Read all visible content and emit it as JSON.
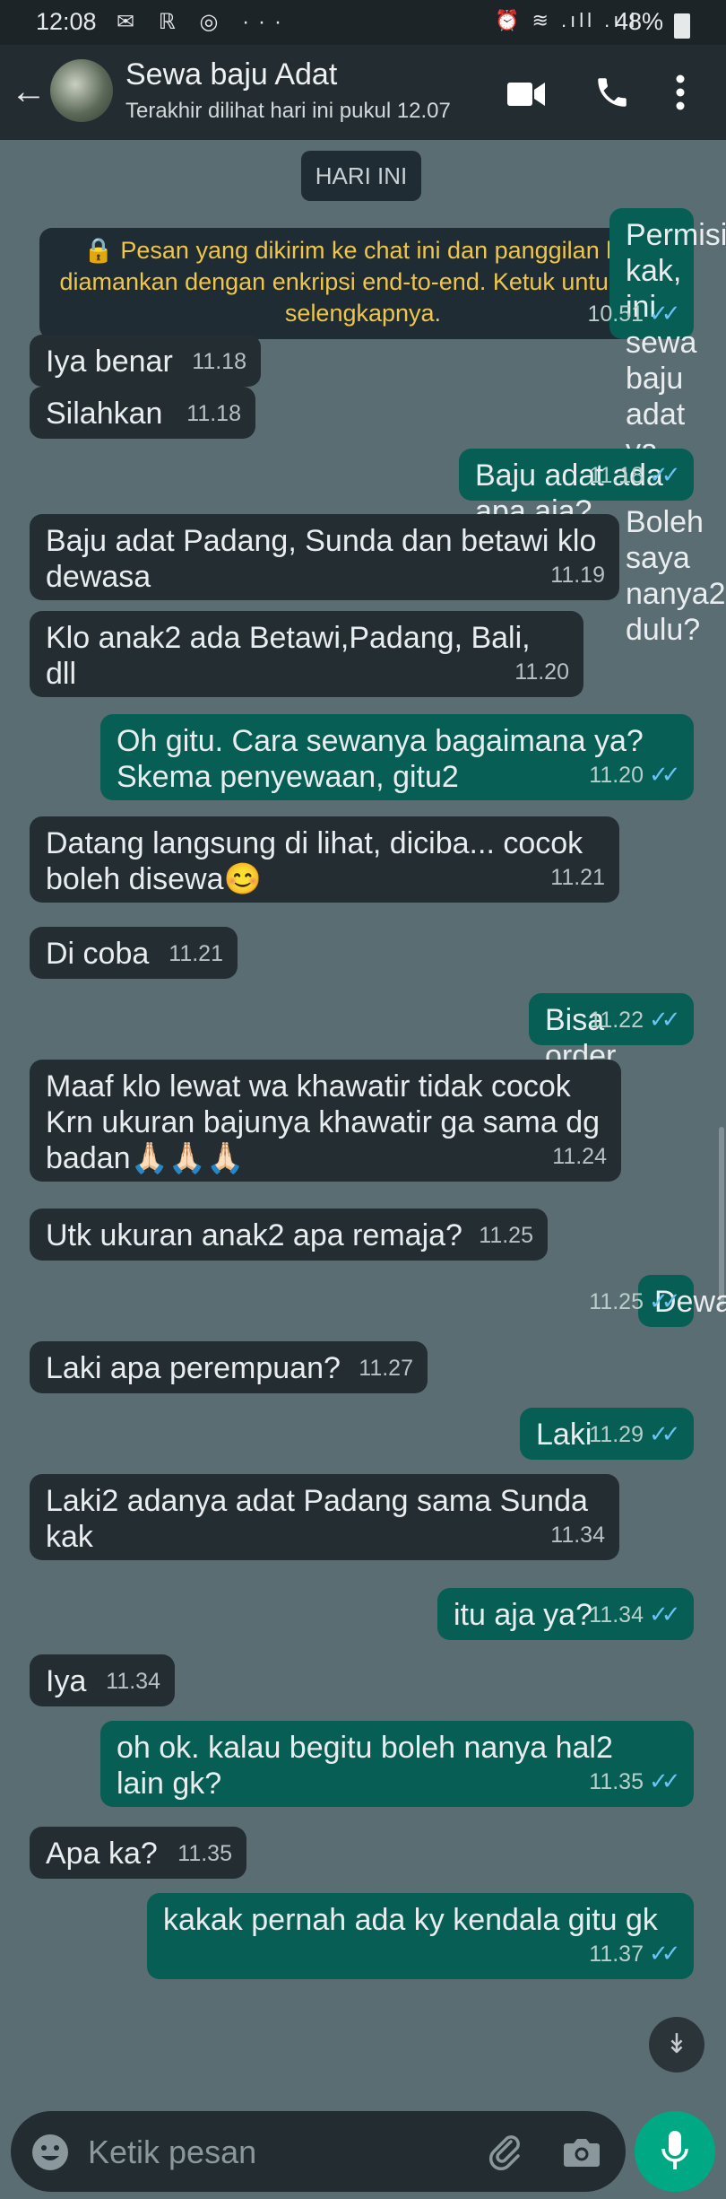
{
  "status_bar": {
    "time": "12:08",
    "left_icons": "✉ ℝ ◎ ···",
    "right_icons": "⏰ ≋ .ıll .ıll",
    "battery": "48%"
  },
  "header": {
    "contact_name": "Sewa baju Adat",
    "last_seen": "Terakhir dilihat hari ini pukul 12.07"
  },
  "chat": {
    "day_label": "HARI INI",
    "encryption_notice": "🔒 Pesan yang dikirim ke chat ini dan panggilan kini diamankan dengan enkripsi end-to-end. Ketuk untuk info selengkapnya.",
    "messages": [
      {
        "dir": "out",
        "text": "Permisi kak, ini sewa baju adat ya kak?\nBoleh saya nanya2 dulu?",
        "time": "10.51",
        "read": true
      },
      {
        "dir": "in",
        "text": "Iya benar",
        "time": "11.18"
      },
      {
        "dir": "in",
        "text": "Silahkan",
        "time": "11.18"
      },
      {
        "dir": "out",
        "text": "Baju adat ada apa aja?",
        "time": "11.18",
        "read": true
      },
      {
        "dir": "in",
        "text": "Baju adat Padang, Sunda dan betawi klo\ndewasa",
        "time": "11.19"
      },
      {
        "dir": "in",
        "text": "Klo anak2 ada Betawi,Padang, Bali, dll",
        "time": "11.20"
      },
      {
        "dir": "out",
        "text": "Oh gitu. Cara sewanya bagaimana ya?\nSkema penyewaan, gitu2",
        "time": "11.20",
        "read": true
      },
      {
        "dir": "in",
        "text": "Datang langsung di lihat, diciba... cocok\nboleh disewa😊",
        "time": "11.21"
      },
      {
        "dir": "in",
        "text": "Di coba",
        "time": "11.21"
      },
      {
        "dir": "out",
        "text": "Bisa order lewat WA?",
        "time": "11.22",
        "read": true
      },
      {
        "dir": "in",
        "text": "Maaf klo lewat wa khawatir tidak cocok\nKrn ukuran bajunya khawatir ga sama dg\nbadan🙏🏻🙏🏻🙏🏻",
        "time": "11.24"
      },
      {
        "dir": "in",
        "text": "Utk ukuran anak2 apa remaja?",
        "time": "11.25"
      },
      {
        "dir": "out",
        "text": "Dewasa",
        "time": "11.25",
        "read": true
      },
      {
        "dir": "in",
        "text": "Laki apa perempuan?",
        "time": "11.27"
      },
      {
        "dir": "out",
        "text": "Laki",
        "time": "11.29",
        "read": true
      },
      {
        "dir": "in",
        "text": "Laki2 adanya adat Padang sama Sunda\nkak",
        "time": "11.34"
      },
      {
        "dir": "out",
        "text": "itu aja ya?",
        "time": "11.34",
        "read": true
      },
      {
        "dir": "in",
        "text": "Iya",
        "time": "11.34"
      },
      {
        "dir": "out",
        "text": "oh ok. kalau begitu boleh nanya hal2\nlain gk?",
        "time": "11.35",
        "read": true
      },
      {
        "dir": "in",
        "text": "Apa ka?",
        "time": "11.35"
      },
      {
        "dir": "out",
        "text": "kakak pernah ada ky kendala gitu gk",
        "time": "11.37",
        "read": true
      }
    ]
  },
  "input": {
    "placeholder": "Ketik pesan"
  },
  "colors": {
    "incoming_bubble": "#232d32",
    "outgoing_bubble": "#075e54",
    "read_tick": "#6ac3f2",
    "mic_button": "#00a884",
    "notice_text": "#f0c64a"
  },
  "icons": [
    "back-arrow-icon",
    "video-call-icon",
    "phone-icon",
    "more-vert-icon",
    "emoji-icon",
    "attach-icon",
    "camera-icon",
    "mic-icon",
    "chevron-double-down-icon"
  ]
}
